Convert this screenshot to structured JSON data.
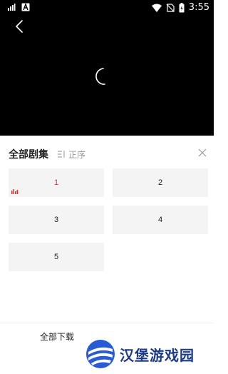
{
  "status_bar": {
    "time": "3:55",
    "icons": [
      "signal-chart-icon",
      "a-notification-icon",
      "wifi-icon",
      "no-sim-icon",
      "battery-icon"
    ]
  },
  "player": {
    "back_icon": "chevron-left-icon",
    "loading_icon": "spinner-icon"
  },
  "panel": {
    "title": "全部剧集",
    "sort_label": "正序",
    "sort_icon": "sort-icon",
    "close_icon": "close-icon",
    "active_color": "#e02e2e",
    "episodes": [
      {
        "label": "1",
        "active": true
      },
      {
        "label": "2",
        "active": false
      },
      {
        "label": "3",
        "active": false
      },
      {
        "label": "4",
        "active": false
      },
      {
        "label": "5",
        "active": false
      }
    ]
  },
  "bottom": {
    "download_all_label": "全部下载",
    "watermark_text": "汉堡游戏园"
  }
}
